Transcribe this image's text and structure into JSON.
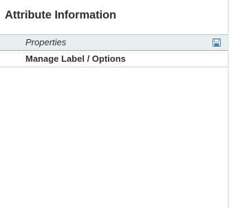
{
  "panel": {
    "title": "Attribute Information"
  },
  "tabs": [
    {
      "label": "Properties",
      "icon": "save-icon"
    },
    {
      "label": "Manage Label / Options"
    }
  ]
}
